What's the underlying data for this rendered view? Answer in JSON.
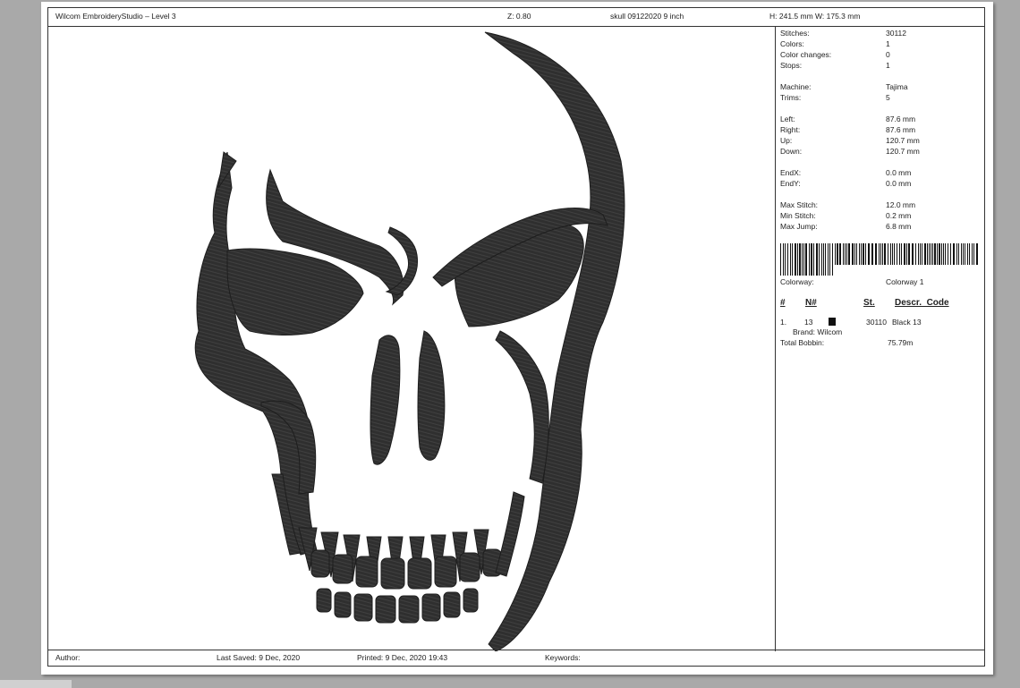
{
  "header": {
    "app_title": "Wilcom EmbroideryStudio – Level 3",
    "zoom": "Z: 0.80",
    "file_name": "skull 09122020 9 inch",
    "dimensions": "H: 241.5 mm   W: 175.3 mm"
  },
  "info": {
    "stitches_label": "Stitches:",
    "stitches_value": "30112",
    "colors_label": "Colors:",
    "colors_value": "1",
    "color_changes_label": "Color changes:",
    "color_changes_value": "0",
    "stops_label": "Stops:",
    "stops_value": "1",
    "machine_label": "Machine:",
    "machine_value": "Tajima",
    "trims_label": "Trims:",
    "trims_value": "5",
    "left_label": "Left:",
    "left_value": "87.6 mm",
    "right_label": "Right:",
    "right_value": "87.6 mm",
    "up_label": "Up:",
    "up_value": "120.7 mm",
    "down_label": "Down:",
    "down_value": "120.7 mm",
    "endx_label": "EndX:",
    "endx_value": "0.0 mm",
    "endy_label": "EndY:",
    "endy_value": "0.0 mm",
    "max_stitch_label": "Max Stitch:",
    "max_stitch_value": "12.0 mm",
    "min_stitch_label": "Min Stitch:",
    "min_stitch_value": "0.2 mm",
    "max_jump_label": "Max Jump:",
    "max_jump_value": "6.8 mm",
    "colorway_label": "Colorway:",
    "colorway_value": "Colorway 1"
  },
  "thread_table": {
    "headers": [
      "#",
      "N#",
      "St.",
      "Descr._Code"
    ],
    "rows": [
      {
        "index": "1.",
        "number": "13",
        "stitches": "30110",
        "description": "Black 13",
        "brand": "Brand: Wilcom"
      }
    ],
    "total_bobbin_label": "Total Bobbin:",
    "total_bobbin_value": "75.79m",
    "swatch_color": "#111111"
  },
  "footer": {
    "author": "Author:",
    "last_saved": "Last Saved:  9 Dec, 2020",
    "printed": "Printed:  9 Dec, 2020 19:43",
    "keywords": "Keywords:"
  },
  "design": {
    "fill_color": "#2b2b2b",
    "icon": "skull-embroidery-design"
  }
}
